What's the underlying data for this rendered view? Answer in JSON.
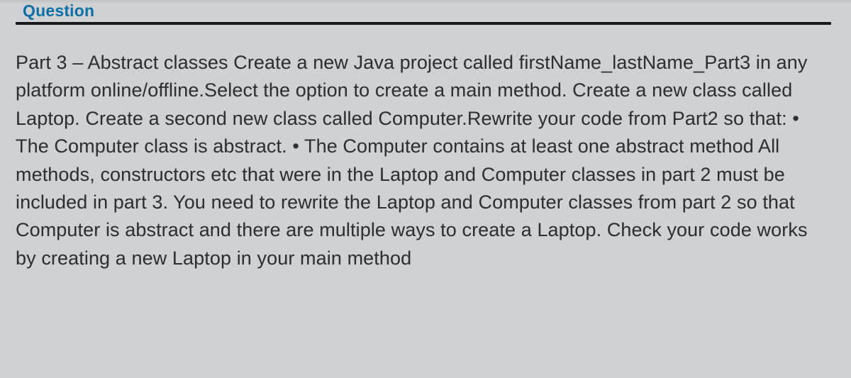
{
  "header": {
    "label": "Question"
  },
  "content": {
    "body": "Part 3 – Abstract classes Create a new Java project called firstName_lastName_Part3 in any platform online/offline.Select the option to create a main method. Create a new class called Laptop. Create a second new class called Computer.Rewrite your code from Part2 so that: • The Computer class is abstract. • The Computer contains at least one abstract method All methods, constructors etc that were in the Laptop and Computer classes in part 2 must be included in part 3. You need to rewrite the Laptop and Computer classes from part 2 so that Computer is abstract and there are multiple ways to create a Laptop. Check your code works by creating a new Laptop in your main method"
  }
}
